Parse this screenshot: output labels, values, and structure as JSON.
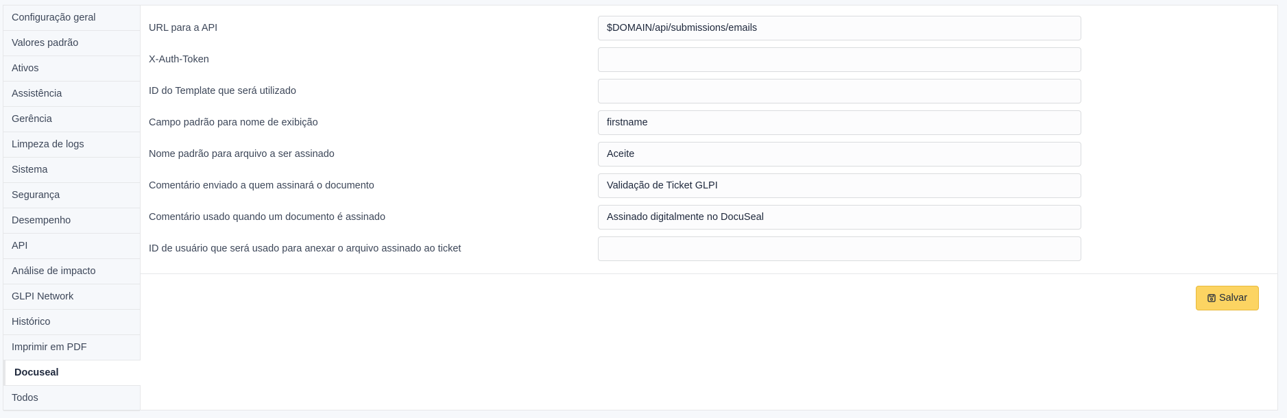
{
  "sidebar": {
    "items": [
      {
        "label": "Configuração geral"
      },
      {
        "label": "Valores padrão"
      },
      {
        "label": "Ativos"
      },
      {
        "label": "Assistência"
      },
      {
        "label": "Gerência"
      },
      {
        "label": "Limpeza de logs"
      },
      {
        "label": "Sistema"
      },
      {
        "label": "Segurança"
      },
      {
        "label": "Desempenho"
      },
      {
        "label": "API"
      },
      {
        "label": "Análise de impacto"
      },
      {
        "label": "GLPI Network"
      },
      {
        "label": "Histórico"
      },
      {
        "label": "Imprimir em PDF"
      },
      {
        "label": "Docuseal",
        "active": true
      },
      {
        "label": "Todos"
      }
    ]
  },
  "form": {
    "fields": [
      {
        "label": "URL para a API",
        "value": "$DOMAIN/api/submissions/emails"
      },
      {
        "label": "X-Auth-Token",
        "value": ""
      },
      {
        "label": "ID do Template que será utilizado",
        "value": ""
      },
      {
        "label": "Campo padrão para nome de exibição",
        "value": "firstname"
      },
      {
        "label": "Nome padrão para arquivo a ser assinado",
        "value": "Aceite"
      },
      {
        "label": "Comentário enviado a quem assinará o documento",
        "value": "Validação de Ticket GLPI"
      },
      {
        "label": "Comentário usado quando um documento é assinado",
        "value": "Assinado digitalmente no DocuSeal"
      },
      {
        "label": "ID de usuário que será usado para anexar o arquivo assinado ao ticket",
        "value": ""
      }
    ]
  },
  "actions": {
    "save_label": "Salvar",
    "save_icon": "floppy-disk-icon",
    "save_color": "#fcd462"
  }
}
